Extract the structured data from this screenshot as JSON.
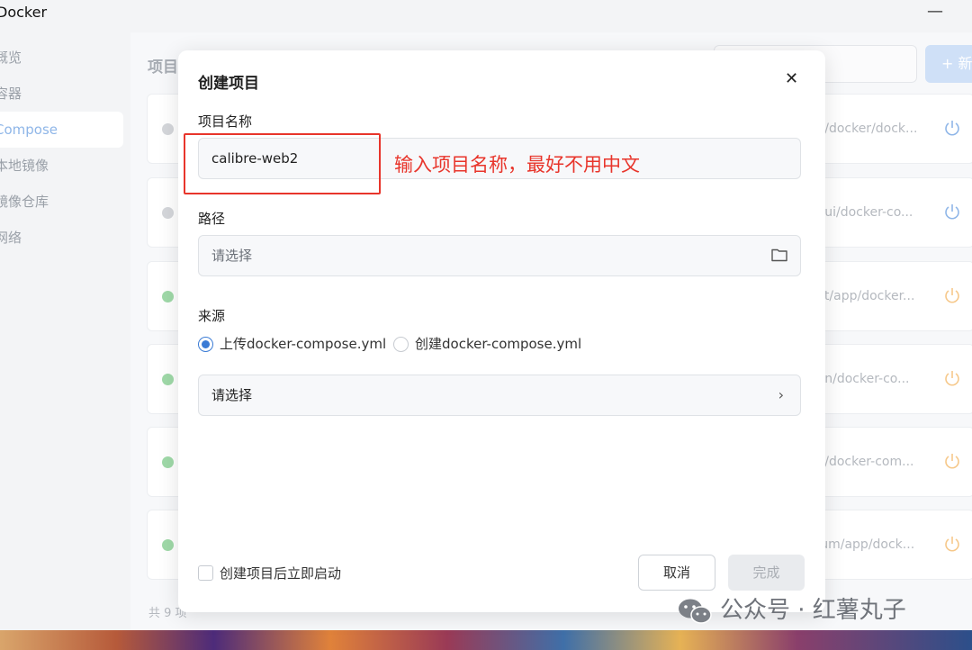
{
  "app": {
    "title": "Docker"
  },
  "sidebar": {
    "items": [
      {
        "label": "概览",
        "active": false
      },
      {
        "label": "容器",
        "active": false
      },
      {
        "label": "Compose",
        "active": true
      },
      {
        "label": "本地镜像",
        "active": false
      },
      {
        "label": "镜像仓库",
        "active": false
      },
      {
        "label": "网络",
        "active": false
      }
    ]
  },
  "main": {
    "title": "项目",
    "new_button_label": "+ 新",
    "rows": [
      {
        "status": "stopped",
        "path": "...n/docker/dock..."
      },
      {
        "status": "stopped",
        "path": "...bui/docker-co..."
      },
      {
        "status": "running",
        "path": "...at/app/docker..."
      },
      {
        "status": "running",
        "path": "...dn/docker-co..."
      },
      {
        "status": "running",
        "path": "...n/docker-com..."
      },
      {
        "status": "running",
        "path": "...ium/app/dock..."
      }
    ],
    "total_text": "共 9 项"
  },
  "modal": {
    "title": "创建项目",
    "name_label": "项目名称",
    "name_value": "calibre-web2",
    "path_label": "路径",
    "path_placeholder": "请选择",
    "source_label": "来源",
    "source_options": [
      {
        "label": "上传docker-compose.yml",
        "selected": true
      },
      {
        "label": "创建docker-compose.yml",
        "selected": false
      }
    ],
    "file_select_placeholder": "请选择",
    "autostart_label": "创建项目后立即启动",
    "autostart_checked": false,
    "cancel_label": "取消",
    "done_label": "完成"
  },
  "annotation": {
    "text": "输入项目名称，最好不用中文",
    "color": "#e8352b"
  },
  "watermark": {
    "text": "公众号 · 红薯丸子"
  },
  "colors": {
    "accent": "#3a7bd5",
    "running": "#9fd9a8",
    "stopped": "#d4d6da",
    "power_running": "#f6c88a",
    "power_stopped": "#8fb6e8"
  }
}
